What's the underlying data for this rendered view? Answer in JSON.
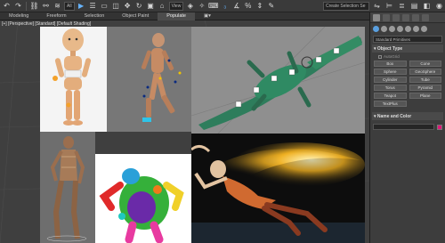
{
  "ribbon": {
    "tabs": [
      {
        "label": "Modeling"
      },
      {
        "label": "Freeform"
      },
      {
        "label": "Selection"
      },
      {
        "label": "Object Paint"
      },
      {
        "label": "Populate"
      }
    ]
  },
  "toolbar": {
    "filter_dropdown": "All",
    "view_dropdown": "View",
    "selection_set": "Create Selection Se"
  },
  "viewport": {
    "label": "[+] [Perspective] [Standard] [Default Shading]"
  },
  "command_panel": {
    "dropdown": "Standard Primitives",
    "object_type": {
      "title": "Object Type",
      "autogrid": "AutoGrid",
      "buttons": [
        "Box",
        "Cone",
        "Sphere",
        "GeoSphere",
        "Cylinder",
        "Tube",
        "Torus",
        "Pyramid",
        "Teapot",
        "Plane",
        "TextPlus"
      ]
    },
    "name_color": {
      "title": "Name and Color",
      "color": "#e0177a"
    }
  }
}
